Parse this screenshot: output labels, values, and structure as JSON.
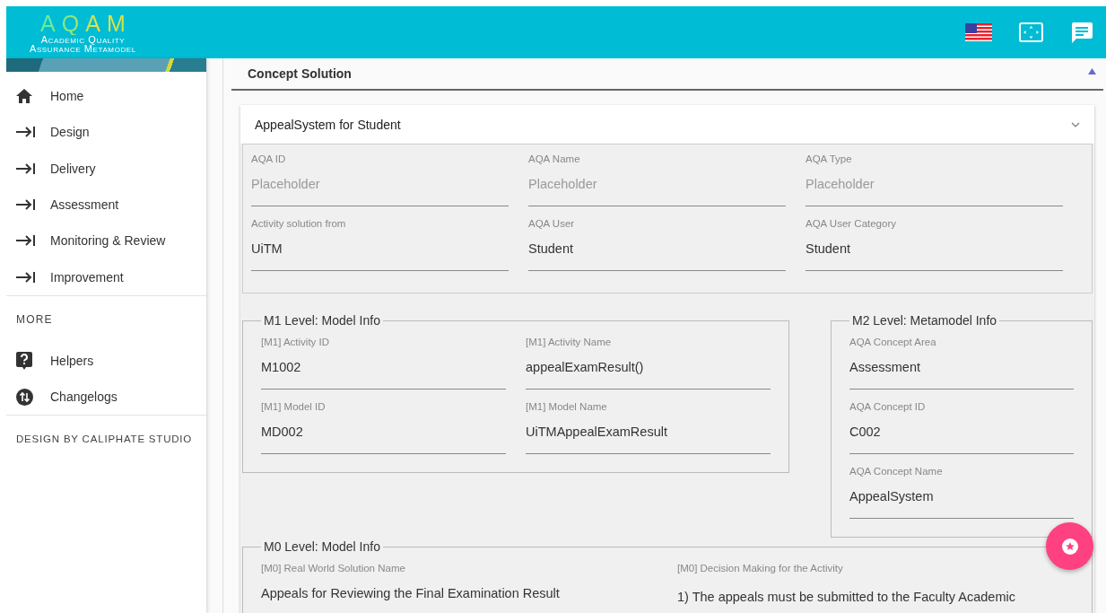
{
  "header": {
    "logo_title": "AQAM",
    "logo_subtitle": [
      "Academic Quality",
      "Assurance Metamodel"
    ]
  },
  "sidebar": {
    "items": [
      {
        "kind": "home",
        "label": "Home"
      },
      {
        "kind": "section",
        "label": "Design"
      },
      {
        "kind": "section",
        "label": "Delivery"
      },
      {
        "kind": "section",
        "label": "Assessment"
      },
      {
        "kind": "section",
        "label": "Monitoring & Review"
      },
      {
        "kind": "section",
        "label": "Improvement"
      }
    ],
    "more_heading": "MORE",
    "more_items": [
      {
        "kind": "help",
        "label": "Helpers"
      },
      {
        "kind": "changelog",
        "label": "Changelogs"
      }
    ],
    "footer": "DESIGN BY CALIPHATE STUDIO"
  },
  "panel": {
    "title": "Concept Solution",
    "expanded": true,
    "card": {
      "title": "AppealSystem for Student",
      "expanded": true,
      "fields": [
        {
          "label": "AQA ID",
          "placeholder": "Placeholder"
        },
        {
          "label": "AQA Name",
          "placeholder": "Placeholder"
        },
        {
          "label": "AQA Type",
          "placeholder": "Placeholder"
        },
        {
          "label": "Activity solution from",
          "value": "UiTM"
        },
        {
          "label": "AQA User",
          "value": "Student"
        },
        {
          "label": "AQA User Category",
          "value": "Student"
        }
      ],
      "m1": {
        "legend": "M1 Level: Model Info",
        "fields": [
          {
            "label": "[M1] Activity ID",
            "value": "M1002"
          },
          {
            "label": "[M1] Activity Name",
            "value": "appealExamResult()"
          },
          {
            "label": "[M1] Model ID",
            "value": "MD002"
          },
          {
            "label": "[M1] Model Name",
            "value": "UiTMAppealExamResult"
          }
        ]
      },
      "m2": {
        "legend": "M2 Level: Metamodel Info",
        "fields": [
          {
            "label": "AQA Concept Area",
            "value": "Assessment"
          },
          {
            "label": "AQA Concept ID",
            "value": "C002"
          },
          {
            "label": "AQA Concept Name",
            "value": "AppealSystem"
          }
        ]
      },
      "m0": {
        "legend": "M0 Level: Model Info",
        "fields": [
          {
            "label": "[M0] Real World Solution Name",
            "value": "Appeals for Reviewing the Final Examination Result"
          },
          {
            "label": "[M0] Decision Making for the Activity",
            "value": "1) The appeals must be submitted to the Faculty Academic"
          }
        ]
      }
    }
  }
}
